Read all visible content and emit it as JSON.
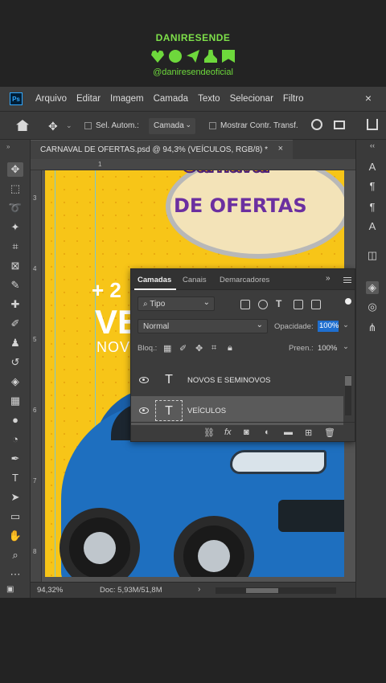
{
  "branding": {
    "name": "DANIRESENDE",
    "handle": "@daniresendeoficial",
    "icons": [
      "heart-icon",
      "chat-bubble-icon",
      "send-icon",
      "user-icon",
      "bookmark-icon"
    ]
  },
  "app": {
    "logo_text": "Ps",
    "menu": [
      "Arquivo",
      "Editar",
      "Imagem",
      "Camada",
      "Texto",
      "Selecionar",
      "Filtro"
    ],
    "close_glyph": "×"
  },
  "options_bar": {
    "auto_select_label": "Sel. Autom.:",
    "auto_select_value": "Camada",
    "show_transform_label": "Mostrar Contr. Transf."
  },
  "document": {
    "tab_title": "CARNAVAL DE OFERTAS.psd @ 94,3% (VEÍCULOS, RGB/8) *",
    "close_glyph": "×"
  },
  "rulers": {
    "top_mark": "1",
    "left": [
      "3",
      "4",
      "5",
      "6",
      "7",
      "8"
    ]
  },
  "artwork": {
    "title_word": "Carnaval",
    "subtitle": "DE OFERTAS",
    "plus_text": "+ 2",
    "big_text": "VE",
    "novos_text": "NOVO"
  },
  "layers_panel": {
    "tabs": [
      "Camadas",
      "Canais",
      "Demarcadores"
    ],
    "filter_label": "Tipo",
    "blend_mode": "Normal",
    "opacity_label": "Opacidade:",
    "opacity_value": "100%",
    "lock_label": "Bloq.:",
    "fill_label": "Preen.:",
    "fill_value": "100%",
    "layers": [
      {
        "name": "NOVOS E SEMINOVOS",
        "type": "T",
        "selected": false,
        "visible": true
      },
      {
        "name": "VEÍCULOS",
        "type": "T",
        "selected": true,
        "visible": true
      }
    ]
  },
  "status_bar": {
    "zoom": "94,32%",
    "doc_info": "Doc: 5,93M/51,8M",
    "arrow": "›"
  },
  "colors": {
    "accent_green": "#6ed83c",
    "canvas_yellow": "#f7c518",
    "selection_blue": "#1f6fcf"
  }
}
